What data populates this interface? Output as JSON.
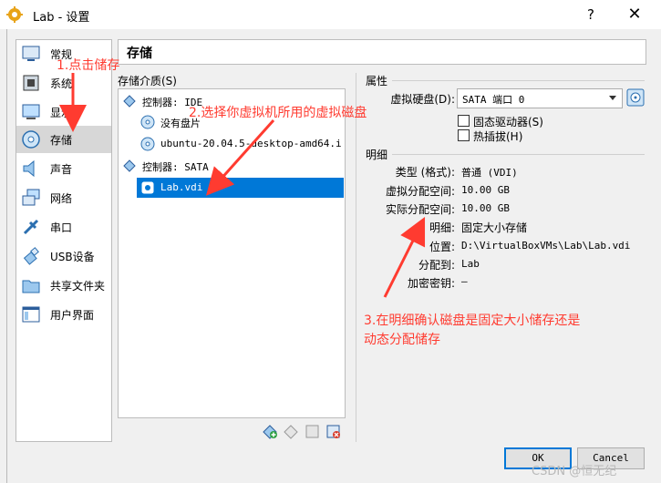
{
  "window": {
    "title": "Lab - 设置",
    "help": "?",
    "close": "✕"
  },
  "sidebar": {
    "items": [
      {
        "label": "常规",
        "icon": "general-icon"
      },
      {
        "label": "系统",
        "icon": "system-icon"
      },
      {
        "label": "显示",
        "icon": "display-icon"
      },
      {
        "label": "存储",
        "icon": "storage-icon",
        "active": true
      },
      {
        "label": "声音",
        "icon": "audio-icon"
      },
      {
        "label": "网络",
        "icon": "network-icon"
      },
      {
        "label": "串口",
        "icon": "serial-port-icon"
      },
      {
        "label": "USB设备",
        "icon": "usb-icon"
      },
      {
        "label": "共享文件夹",
        "icon": "shared-folder-icon"
      },
      {
        "label": "用户界面",
        "icon": "user-interface-icon"
      }
    ]
  },
  "page": {
    "title": "存储"
  },
  "storage": {
    "media_label": "存储介质(S)",
    "tree": [
      {
        "text": "控制器: IDE",
        "icon": "ide-controller-icon"
      },
      {
        "text": "没有盘片",
        "icon": "optical-disc-icon"
      },
      {
        "text": "ubuntu-20.04.5-desktop-amd64.i...",
        "icon": "optical-disc-icon"
      },
      {
        "text": "控制器: SATA",
        "icon": "sata-controller-icon"
      },
      {
        "text": "Lab.vdi",
        "icon": "hard-disk-icon",
        "selected": true
      }
    ]
  },
  "attributes": {
    "label": "属性",
    "virtual_disk_label": "虚拟硬盘(D):",
    "virtual_disk_value": "SATA 端口 0",
    "ssd_label": "固态驱动器(S)",
    "ssd_checked": false,
    "hotplug_label": "热插拔(H)",
    "hotplug_checked": false
  },
  "details": {
    "label": "明细",
    "rows": [
      {
        "label": "类型 (格式):",
        "value": "普通 (VDI)"
      },
      {
        "label": "虚拟分配空间:",
        "value": "10.00 GB"
      },
      {
        "label": "实际分配空间:",
        "value": "10.00 GB"
      },
      {
        "label": "明细:",
        "value": "固定大小存储"
      },
      {
        "label": "位置:",
        "value": "D:\\VirtualBoxVMs\\Lab\\Lab.vdi"
      },
      {
        "label": "分配到:",
        "value": "Lab"
      },
      {
        "label": "加密密钥:",
        "value": "—"
      }
    ]
  },
  "annotations": {
    "step1": "1.点击储存",
    "step2": "2.选择你虚拟机所用的虚拟磁盘",
    "step3_line1": "3.在明细确认磁盘是固定大小储存还是",
    "step3_line2": "动态分配储存"
  },
  "buttons": {
    "ok": "OK",
    "cancel": "Cancel"
  },
  "watermark": "CSDN @恒无纪",
  "colors": {
    "selection": "#0078d7",
    "annotation": "#ff3b30",
    "sidebar_active": "#d7d7d7"
  }
}
